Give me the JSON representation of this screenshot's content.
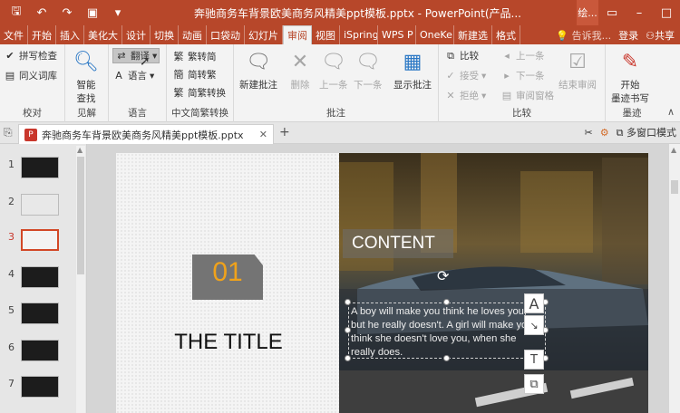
{
  "title_bar": {
    "document_title": "奔驰商务车背景欧美商务风精美ppt模板.pptx - PowerPoint(产品...",
    "account_abbr": "绘..."
  },
  "tabs": [
    "文件",
    "开始",
    "插入",
    "美化大",
    "设计",
    "切换",
    "动画",
    "口袋动",
    "幻灯片",
    "审阅",
    "视图",
    "iSpring",
    "WPS P",
    "OneKe",
    "新建选",
    "格式"
  ],
  "active_tab": "审阅",
  "tabs_right": {
    "search": "告诉我...",
    "login": "登录",
    "share": "共享"
  },
  "ribbon": {
    "proofing": {
      "spell": "拼写检查",
      "thesaurus": "同义词库",
      "label": "校对"
    },
    "insights": {
      "smart_lookup_line1": "智能",
      "smart_lookup_line2": "查找",
      "label": "见解"
    },
    "language": {
      "translate": "翻译",
      "language": "语言",
      "label": "语言"
    },
    "chinese_conv": {
      "to_simplified": "繁转简",
      "to_traditional": "简转繁",
      "convert": "简繁转换",
      "label": "中文简繁转换"
    },
    "comments": {
      "new": "新建批注",
      "delete": "删除",
      "previous": "上一条",
      "next": "下一条",
      "show": "显示批注",
      "label": "批注"
    },
    "compare": {
      "compare": "比较",
      "accept": "接受",
      "reject": "拒绝",
      "prev": "上一条",
      "next": "下一条",
      "pane": "审阅窗格",
      "end": "结束审阅",
      "label": "比较"
    },
    "ink": {
      "start_line1": "开始",
      "start_line2": "墨迹书写",
      "label": "墨迹"
    }
  },
  "doc_tab": {
    "filename": "奔驰商务车背景欧美商务风精美ppt模板.pptx",
    "multi_window": "多窗口模式"
  },
  "thumbnails": [
    {
      "num": "1"
    },
    {
      "num": "2"
    },
    {
      "num": "3"
    },
    {
      "num": "4"
    },
    {
      "num": "5"
    },
    {
      "num": "6"
    },
    {
      "num": "7"
    }
  ],
  "selected_thumbnail": 3,
  "slide": {
    "number": "01",
    "title": "THE TITLE",
    "content_heading": "CONTENT",
    "body_text": "A boy will make you think he loves you, but he really doesn't. A girl will make you think she doesn't love you, when she really does."
  },
  "colors": {
    "accent": "#b7472a",
    "number": "#f0a21b"
  }
}
